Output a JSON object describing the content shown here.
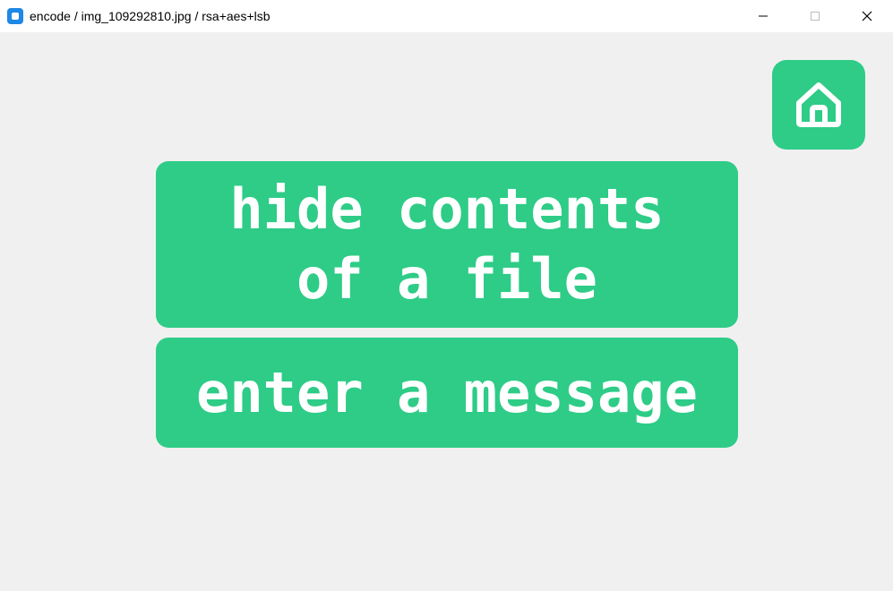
{
  "window": {
    "title": "encode / img_109292810.jpg / rsa+aes+lsb",
    "app_icon": "app-icon",
    "controls": {
      "minimize_icon": "minimize-icon",
      "maximize_icon": "maximize-icon",
      "close_icon": "close-icon"
    }
  },
  "home": {
    "icon": "home-icon"
  },
  "actions": {
    "hide_file_label": "hide contents\nof a file",
    "enter_message_label": "enter a message"
  },
  "colors": {
    "accent": "#2ecc87",
    "background": "#f0f0f0",
    "text_on_accent": "#ffffff"
  }
}
